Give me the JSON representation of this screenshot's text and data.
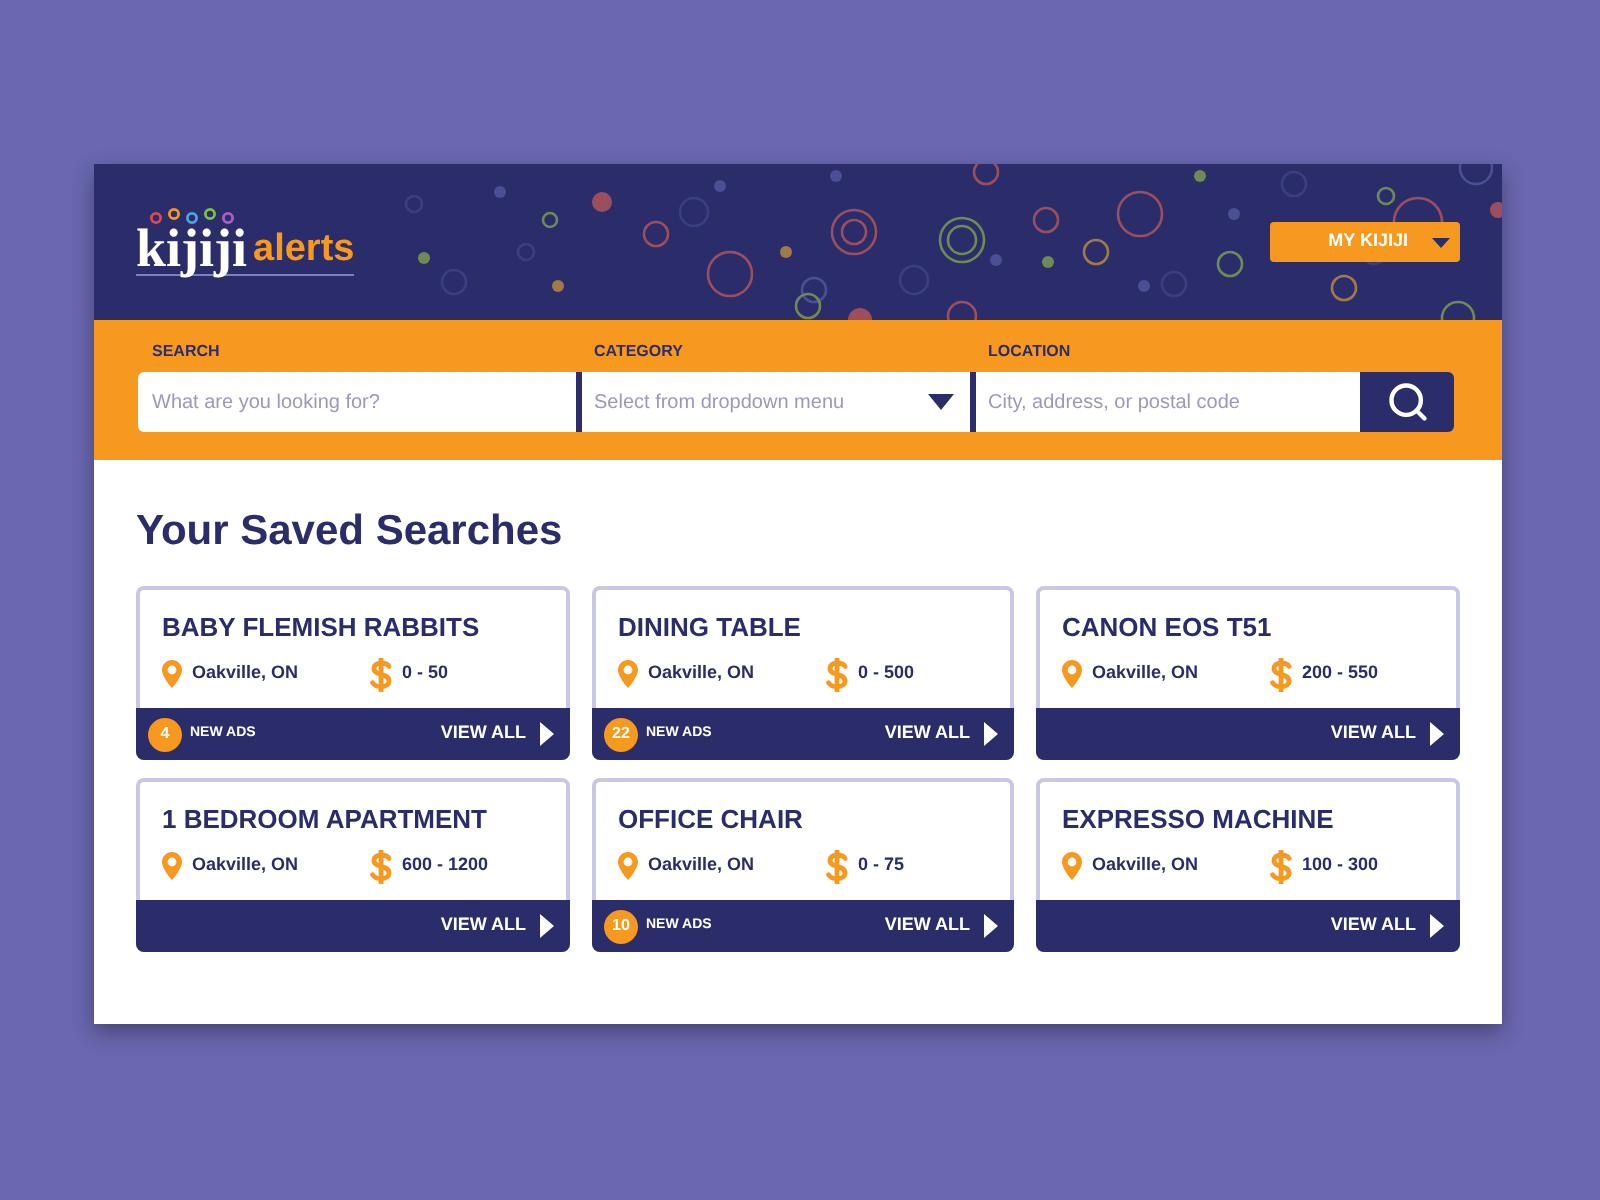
{
  "header": {
    "logo": {
      "brand": "kijiji",
      "product": "alerts"
    },
    "account_button": {
      "label": "MY KIJIJI"
    }
  },
  "search_bar": {
    "fields": [
      {
        "kind": "text",
        "label": "SEARCH",
        "placeholder": "What are you looking for?"
      },
      {
        "kind": "dropdown",
        "label": "CATEGORY",
        "placeholder": "Select from dropdown menu"
      },
      {
        "kind": "text",
        "label": "LOCATION",
        "placeholder": "City, address, or postal code"
      }
    ]
  },
  "saved_searches": {
    "title": "Your Saved Searches",
    "cards": [
      {
        "title": "BABY FLEMISH RABBITS",
        "location": "Oakville, ON",
        "price_range": "0 - 50",
        "new_ads": {
          "count": "4",
          "label": "NEW ADS"
        },
        "action": "VIEW ALL"
      },
      {
        "title": "DINING TABLE",
        "location": "Oakville, ON",
        "price_range": "0 - 500",
        "new_ads": {
          "count": "22",
          "label": "NEW ADS"
        },
        "action": "VIEW ALL"
      },
      {
        "title": "CANON EOS T51",
        "location": "Oakville, ON",
        "price_range": "200 - 550",
        "action": "VIEW ALL"
      },
      {
        "title": "1 BEDROOM APARTMENT",
        "location": "Oakville, ON",
        "price_range": "600 - 1200",
        "action": "VIEW ALL"
      },
      {
        "title": "OFFICE CHAIR",
        "location": "Oakville, ON",
        "price_range": "0 - 75",
        "new_ads": {
          "count": "10",
          "label": "NEW ADS"
        },
        "action": "VIEW ALL"
      },
      {
        "title": "EXPRESSO MACHINE",
        "location": "Oakville, ON",
        "price_range": "100 - 300",
        "action": "VIEW ALL"
      }
    ]
  }
}
